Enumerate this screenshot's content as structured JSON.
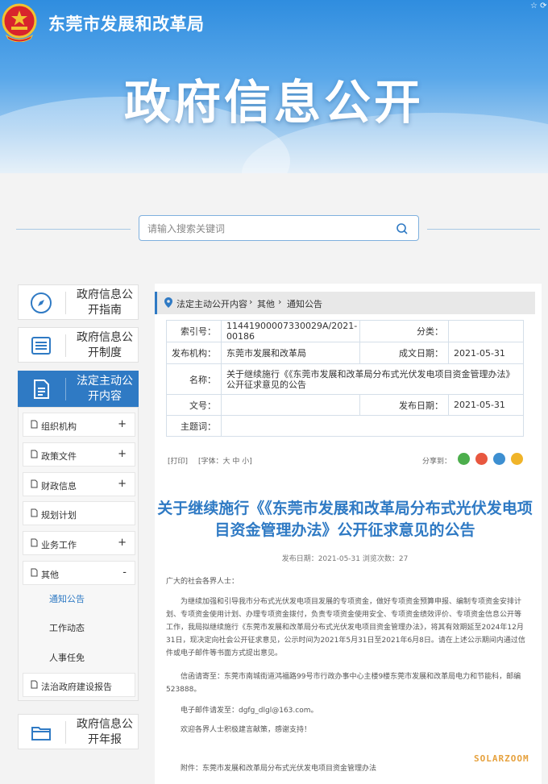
{
  "header": {
    "agency": "东莞市发展和改革局",
    "banner_title": "政府信息公开",
    "corner_icons": "☆ ⟳"
  },
  "search": {
    "placeholder": "请输入搜索关键词"
  },
  "sidebar": {
    "cards": [
      {
        "label": "政府信息公开指南",
        "icon": "compass-icon"
      },
      {
        "label": "政府信息公开制度",
        "icon": "list-icon"
      },
      {
        "label": "法定主动公开内容",
        "icon": "document-icon",
        "active": true
      },
      {
        "label": "政府信息公开年报",
        "icon": "folder-icon"
      }
    ],
    "items": [
      {
        "label": "组织机构",
        "sign": "+"
      },
      {
        "label": "政策文件",
        "sign": "+"
      },
      {
        "label": "财政信息",
        "sign": "+"
      },
      {
        "label": "规划计划",
        "sign": ""
      },
      {
        "label": "业务工作",
        "sign": "+"
      },
      {
        "label": "其他",
        "sign": "-"
      },
      {
        "label": "法治政府建设报告",
        "sign": ""
      }
    ],
    "sub_items": [
      "通知公告",
      "工作动态",
      "人事任免"
    ]
  },
  "breadcrumb": [
    "法定主动公开内容",
    "其他",
    "通知公告"
  ],
  "meta": {
    "index_label": "索引号：",
    "index_value": "11441900007330029A/2021-00186",
    "category_label": "分类：",
    "category_value": "",
    "issuer_label": "发布机构：",
    "issuer_value": "东莞市发展和改革局",
    "created_label": "成文日期：",
    "created_value": "2021-05-31",
    "name_label": "名称：",
    "name_value": "关于继续施行《《东莞市发展和改革局分布式光伏发电项目资金管理办法》公开征求意见的公告",
    "docno_label": "文号：",
    "docno_value": "",
    "published_label": "发布日期：",
    "published_value": "2021-05-31",
    "subject_label": "主题词：",
    "subject_value": ""
  },
  "tools": {
    "print": "[打印]",
    "font": "[字体：大  中  小]",
    "share": "分享到："
  },
  "share_colors": [
    "#4cae4c",
    "#e8573f",
    "#3d8fd1",
    "#f0b429"
  ],
  "article": {
    "title": "关于继续施行《《东莞市发展和改革局分布式光伏发电项目资金管理办法》公开征求意见的公告",
    "pub_line": "发布日期：2021-05-31  浏览次数：27",
    "greeting": "广大的社会各界人士：",
    "body": "为继续加强和引导我市分布式光伏发电项目发展的专项资金，做好专项资金预算申报、编制专项资金安排计划、专项资金使用计划、办理专项资金拨付，负责专项资金使用安全、专项资金绩效评价、专项资金信息公开等工作，我局拟继续施行《东莞市发展和改革局分布式光伏发电项目资金管理办法》，将其有效期延至2024年12月31日，现决定向社会公开征求意见，公示时间为2021年5月31日至2021年6月8日。请在上述公示期间内通过信件或电子邮件等书面方式提出意见。",
    "mail": "信函请寄至：东莞市南城街道鸿福路99号市行政办事中心主楼9楼东莞市发展和改革局电力和节能科，邮编523888。",
    "email": "电子邮件请发至：dgfg_dlgl@163.com。",
    "welcome": "欢迎各界人士积极建言献策，感谢支持！",
    "attachment": "附件：东莞市发展和改革局分布式光伏发电项目资金管理办法"
  },
  "watermark": "SOLARZOOM"
}
